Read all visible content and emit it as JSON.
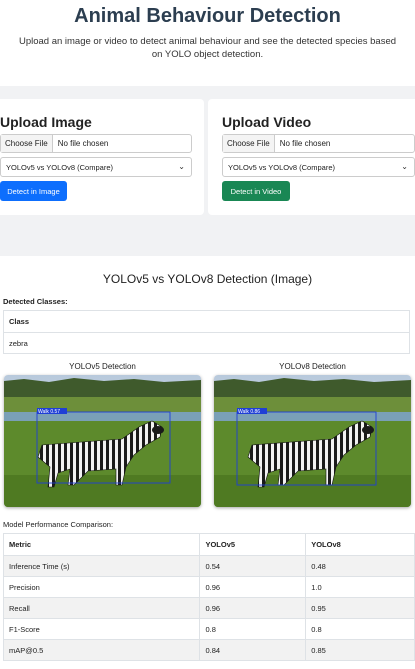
{
  "header": {
    "title": "Animal Behaviour Detection",
    "subtitle": "Upload an image or video to detect animal behaviour and see the detected species based on YOLO object detection."
  },
  "upload_image": {
    "heading": "Upload Image",
    "file_button": "Choose File",
    "file_status": "No file chosen",
    "model_select": "YOLOv5 vs YOLOv8 (Compare)",
    "detect_button": "Detect in Image"
  },
  "upload_video": {
    "heading": "Upload Video",
    "file_button": "Choose File",
    "file_status": "No file chosen",
    "model_select": "YOLOv5 vs YOLOv8 (Compare)",
    "detect_button": "Detect in Video"
  },
  "results": {
    "title": "YOLOv5 vs YOLOv8 Detection (Image)",
    "detected_classes_label": "Detected Classes:",
    "class_header": "Class",
    "classes": [
      "zebra"
    ],
    "yolov5_title": "YOLOv5 Detection",
    "yolov8_title": "YOLOv8 Detection",
    "yolov5_box_label": "Walk 0.57",
    "yolov8_box_label": "Walk 0.86",
    "comparison_label": "Model Performance Comparison:",
    "metrics_headers": [
      "Metric",
      "YOLOv5",
      "YOLOv8"
    ],
    "metrics": [
      [
        "Inference Time (s)",
        "0.54",
        "0.48"
      ],
      [
        "Precision",
        "0.96",
        "1.0"
      ],
      [
        "Recall",
        "0.96",
        "0.95"
      ],
      [
        "F1-Score",
        "0.8",
        "0.8"
      ],
      [
        "mAP@0.5",
        "0.84",
        "0.85"
      ]
    ]
  },
  "colors": {
    "title": "#2c3e50",
    "detect_image_button": "#0d6efd",
    "detect_video_button": "#198754",
    "bounding_box": "#1f3fd6"
  },
  "icons": {
    "select_arrow": "chevron-down-icon"
  }
}
